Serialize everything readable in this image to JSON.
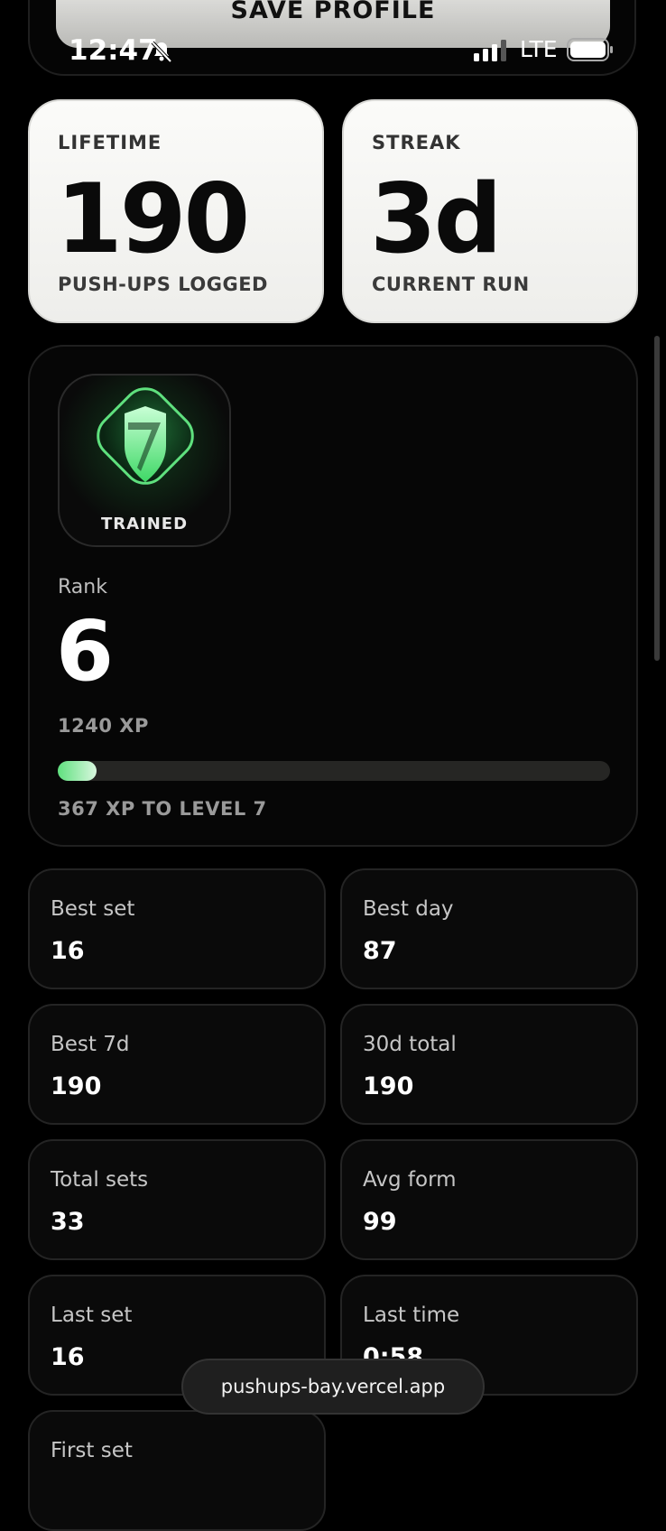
{
  "top": {
    "save_label": "SAVE PROFILE"
  },
  "status_bar": {
    "time": "12:47",
    "network": "LTE"
  },
  "lifetime": {
    "label": "LIFETIME",
    "value": "190",
    "sub": "PUSH-UPS LOGGED"
  },
  "streak": {
    "label": "STREAK",
    "value": "3d",
    "sub": "CURRENT RUN"
  },
  "rank": {
    "badge_label": "TRAINED",
    "label": "Rank",
    "value": "6",
    "xp": "1240 XP",
    "progress": 0.07,
    "to_next": "367 XP TO LEVEL 7"
  },
  "stats": [
    {
      "label": "Best set",
      "value": "16"
    },
    {
      "label": "Best day",
      "value": "87"
    },
    {
      "label": "Best 7d",
      "value": "190"
    },
    {
      "label": "30d total",
      "value": "190"
    },
    {
      "label": "Total sets",
      "value": "33"
    },
    {
      "label": "Avg form",
      "value": "99"
    },
    {
      "label": "Last set",
      "value": "16"
    },
    {
      "label": "Last time",
      "value": "0:58"
    }
  ],
  "next_tile_label": "First set",
  "browser": {
    "url": "pushups-bay.vercel.app"
  },
  "colors": {
    "accent": "#5fe07e",
    "background": "#000000",
    "card_light": "#f6f6f3"
  }
}
